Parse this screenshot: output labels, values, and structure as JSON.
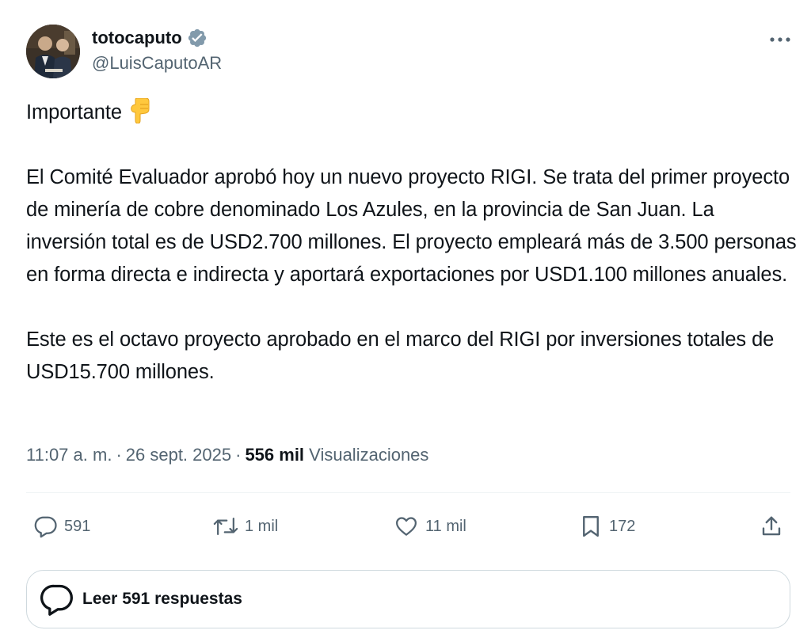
{
  "author": {
    "display_name": "totocaputo",
    "handle": "@LuisCaputoAR"
  },
  "tweet": {
    "paragraphs": [
      "Importante",
      "El Comité Evaluador aprobó hoy un nuevo proyecto RIGI. Se trata del primer proyecto de minería de cobre denominado Los Azules, en la provincia de San Juan. La inversión total es de USD2.700 millones. El proyecto empleará más de 3.500 personas en forma directa e indirecta y aportará exportaciones por USD1.100 millones anuales.",
      "Este es el octavo proyecto aprobado en el marco del RIGI por inversiones totales de USD15.700 millones."
    ],
    "emoji_icon": "backhand-index-pointing-down-icon"
  },
  "meta": {
    "time": "11:07 a. m.",
    "separator": "·",
    "date": "26 sept. 2025",
    "views_count": "556 mil",
    "views_label": "Visualizaciones"
  },
  "actions": {
    "replies": "591",
    "reposts": "1 mil",
    "likes": "11 mil",
    "bookmarks": "172"
  },
  "reply_bar": {
    "label": "Leer 591 respuestas"
  },
  "colors": {
    "text": "#0f1419",
    "secondary": "#536471",
    "verified": "#829aab",
    "divider": "#eff3f4",
    "emoji": "#ffc83d"
  }
}
